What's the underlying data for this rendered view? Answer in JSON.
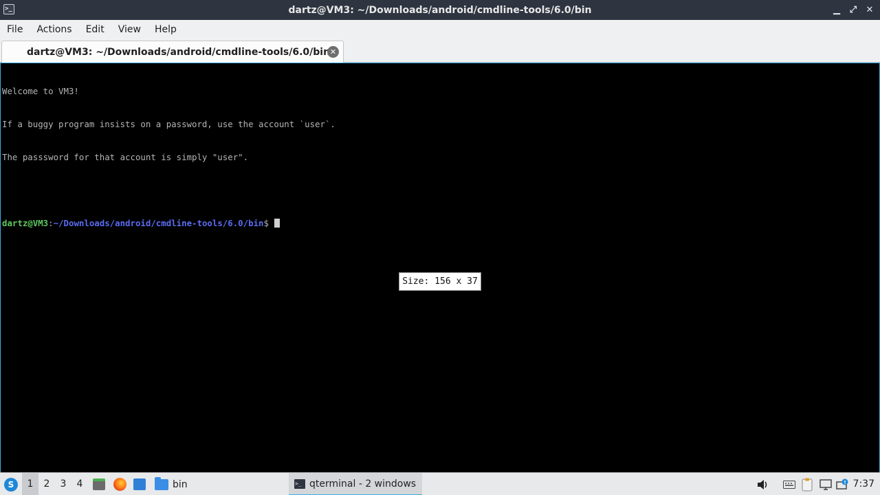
{
  "window": {
    "title": "dartz@VM3: ~/Downloads/android/cmdline-tools/6.0/bin",
    "app_icon": ">_",
    "controls": {
      "minimize": "▁",
      "maximize": "⤢",
      "close": "✕"
    }
  },
  "menu": {
    "items": [
      "File",
      "Actions",
      "Edit",
      "View",
      "Help"
    ]
  },
  "tab": {
    "label": "dartz@VM3: ~/Downloads/android/cmdline-tools/6.0/bin",
    "close_glyph": "✕"
  },
  "terminal": {
    "lines": [
      "Welcome to VM3!",
      "If a buggy program insists on a password, use the account `user`.",
      "The passsword for that account is simply \"user\".",
      ""
    ],
    "prompt": {
      "user_host": "dartz@VM3",
      "colon": ":",
      "path": "~/Downloads/android/cmdline-tools/6.0/bin",
      "dollar": "$"
    },
    "size_popup": "Size: 156 x 37"
  },
  "taskbar": {
    "start_icon": "start-menu-icon",
    "workspaces": [
      "1",
      "2",
      "3",
      "4"
    ],
    "active_workspace": "1",
    "quicklaunch": [
      "file-manager-icon",
      "firefox-icon",
      "show-desktop-icon"
    ],
    "tasks": [
      {
        "label": "bin",
        "icon": "folder-icon"
      },
      {
        "label": "qterminal - 2 windows",
        "icon": "terminal-icon"
      }
    ],
    "tray": [
      "volume-icon",
      "keyboard-icon",
      "clipboard-icon",
      "display-icon",
      "network-update-icon"
    ],
    "clock": "7:37"
  },
  "colors": {
    "titlebar_bg": "#2e3440",
    "accent": "#3daee9",
    "prompt_user": "#5dc85d",
    "prompt_path": "#5a6cf0",
    "terminal_fg": "#b4b4b4"
  }
}
